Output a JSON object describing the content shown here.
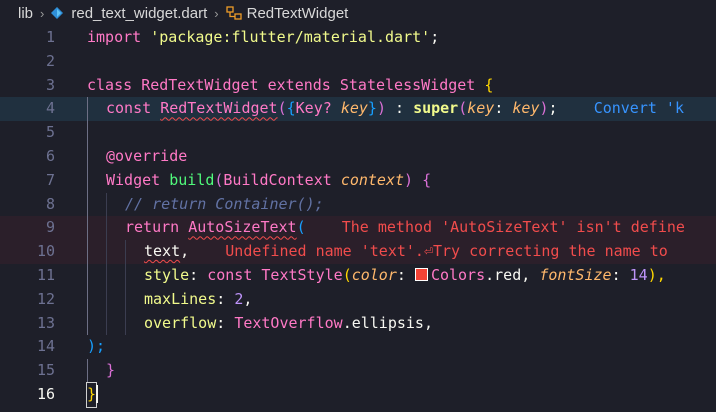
{
  "breadcrumb": {
    "folder": "lib",
    "file": "red_text_widget.dart",
    "symbol": "RedTextWidget"
  },
  "lines": {
    "n1": "1",
    "n2": "2",
    "n3": "3",
    "n4": "4",
    "n5": "5",
    "n6": "6",
    "n7": "7",
    "n8": "8",
    "n9": "9",
    "n10": "10",
    "n11": "11",
    "n12": "12",
    "n13": "13",
    "n14": "14",
    "n15": "15",
    "n16": "16"
  },
  "code": {
    "l1_import": "import",
    "l1_str": "'package:flutter/material.dart'",
    "l1_semi": ";",
    "l3_class": "class",
    "l3_name": "RedTextWidget",
    "l3_extends": "extends",
    "l3_super": "StatelessWidget",
    "l3_brace": "{",
    "l4_const": "const",
    "l4_ctor": "RedTextWidget",
    "l4_open": "(",
    "l4_obrace": "{",
    "l4_type": "Key",
    "l4_q": "?",
    "l4_key": "key",
    "l4_cbrace": "}",
    "l4_close": ")",
    "l4_colon": " : ",
    "l4_superkw": "super",
    "l4_sopen": "(",
    "l4_named": "key",
    "l4_colon2": ": ",
    "l4_val": "key",
    "l4_sclose": ")",
    "l4_semi": ";",
    "l4_hint": "Convert 'k",
    "l6_ann": "@override",
    "l7_type": "Widget",
    "l7_fn": "build",
    "l7_open": "(",
    "l7_ptype": "BuildContext",
    "l7_pname": "context",
    "l7_close": ")",
    "l7_brace": "{",
    "l8_comment": "// return Container();",
    "l9_return": "return",
    "l9_call": "AutoSizeText",
    "l9_paren": "(",
    "l9_err": "The method 'AutoSizeText' isn't define",
    "l10_text": "text",
    "l10_comma": ",",
    "l10_err": "Undefined name 'text'.⏎Try correcting the name to",
    "l11_style": "style",
    "l11_colon": ": ",
    "l11_const": "const",
    "l11_ts": "TextStyle",
    "l11_open": "(",
    "l11_color": "color",
    "l11_colon2": ": ",
    "l11_colors": "Colors",
    "l11_red": ".red, ",
    "l11_fs": "fontSize",
    "l11_colon3": ": ",
    "l11_num": "14",
    "l11_close": "),",
    "l12_ml": "maxLines",
    "l12_colon": ": ",
    "l12_num": "2",
    "l12_comma": ",",
    "l13_of": "overflow",
    "l13_colon": ": ",
    "l13_to": "TextOverflow",
    "l13_rest": ".ellipsis,",
    "l14": ");",
    "l15": "}",
    "l16": "}"
  },
  "colors": {
    "background": "#1e1f29",
    "current_line": "#20303f",
    "error": "#f14c4c",
    "info": "#3794ff",
    "swatch_red": "#f44336"
  }
}
